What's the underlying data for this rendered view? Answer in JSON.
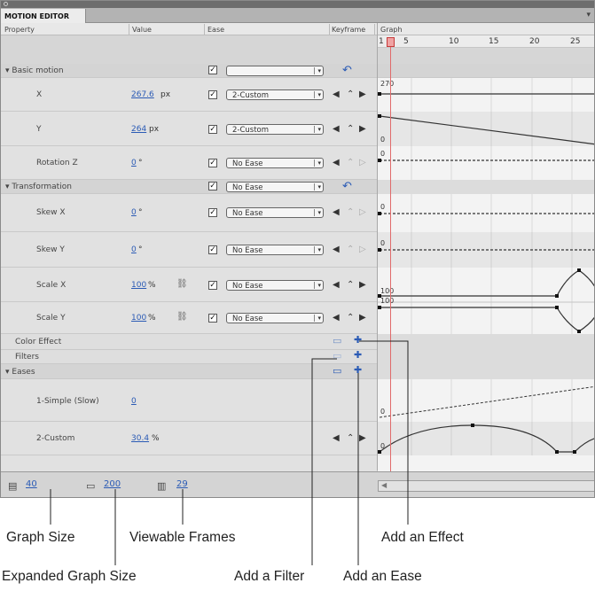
{
  "panel": {
    "tab_label": "MOTION EDITOR",
    "menu_glyph": "▾"
  },
  "columns": {
    "property": "Property",
    "value": "Value",
    "ease": "Ease",
    "keyframe": "Keyframe",
    "graph": "Graph"
  },
  "ruler": {
    "ticks": [
      "1",
      "5",
      "10",
      "15",
      "20",
      "25"
    ]
  },
  "sections": {
    "basic_motion": "Basic motion",
    "transformation": "Transformation",
    "color_effect": "Color Effect",
    "filters": "Filters",
    "eases": "Eases"
  },
  "properties": {
    "x": {
      "label": "X",
      "value": "267.6",
      "unit": "px",
      "ease": "2-Custom",
      "graph_label": "270"
    },
    "y": {
      "label": "Y",
      "value": "264",
      "unit": "px",
      "ease": "2-Custom",
      "graph_label": "0"
    },
    "rotation_z": {
      "label": "Rotation Z",
      "value": "0",
      "unit": "°",
      "ease": "No Ease",
      "graph_label": "0"
    },
    "skew_x": {
      "label": "Skew X",
      "value": "0",
      "unit": "°",
      "ease": "No Ease",
      "graph_label": "0"
    },
    "skew_y": {
      "label": "Skew Y",
      "value": "0",
      "unit": "°",
      "ease": "No Ease",
      "graph_label": "0"
    },
    "scale_x": {
      "label": "Scale X",
      "value": "100",
      "unit": "%",
      "ease": "No Ease",
      "graph_label": "100"
    },
    "scale_y": {
      "label": "Scale Y",
      "value": "100",
      "unit": "%",
      "ease": "No Ease",
      "graph_label": "100"
    }
  },
  "eases": {
    "simple": {
      "label": "1-Simple (Slow)",
      "value": "0",
      "graph_label": "0"
    },
    "custom": {
      "label": "2-Custom",
      "value": "30.4",
      "unit": "%",
      "graph_label": "0"
    }
  },
  "footer": {
    "graph_size": "40",
    "expanded_graph_size": "200",
    "viewable_frames": "29"
  },
  "callouts": {
    "graph_size": "Graph Size",
    "viewable_frames": "Viewable Frames",
    "add_an_effect": "Add an Effect",
    "expanded_graph_size": "Expanded Graph Size",
    "add_a_filter": "Add a Filter",
    "add_an_ease": "Add an Ease"
  },
  "colors": {
    "link_blue": "#2b5bb5",
    "playhead_red": "#e06b6b"
  },
  "icons": {
    "checkbox": "☑",
    "add": "plus-icon",
    "remove": "minus-icon",
    "reset": "reset-arrow-icon",
    "prev_keyframe": "◀",
    "next_keyframe": "▶",
    "add_keyframe": "◇"
  }
}
